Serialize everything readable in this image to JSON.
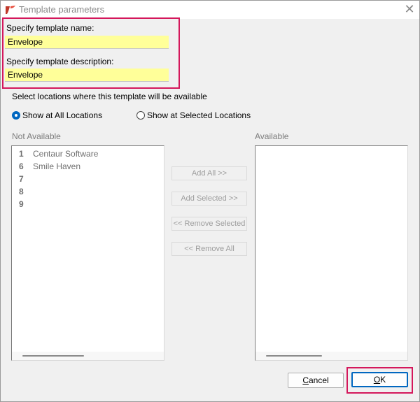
{
  "window": {
    "title": "Template parameters",
    "app_icon": "app-logo-icon",
    "close_icon": "close-icon",
    "close_glyph": "✕"
  },
  "fields": {
    "name_label": "Specify template name:",
    "name_value": "Envelope",
    "description_label": "Specify template description:",
    "description_value": "Envelope"
  },
  "locations": {
    "heading": "Select locations where this template will be available",
    "options": [
      {
        "label": "Show at All Locations",
        "selected": true
      },
      {
        "label": "Show at Selected Locations",
        "selected": false
      }
    ]
  },
  "not_available": {
    "header": "Not Available",
    "items": [
      {
        "num": "1",
        "name": "Centaur Software"
      },
      {
        "num": "6",
        "name": "Smile Haven"
      },
      {
        "num": "7",
        "name": ""
      },
      {
        "num": "8",
        "name": ""
      },
      {
        "num": "9",
        "name": ""
      }
    ]
  },
  "available": {
    "header": "Available",
    "items": []
  },
  "transfer_buttons": {
    "add_all": "Add All >>",
    "add_selected": "Add Selected >>",
    "remove_selected": "<< Remove Selected",
    "remove_all": "<< Remove All"
  },
  "footer": {
    "cancel_first": "C",
    "cancel_rest": "ancel",
    "ok_first": "O",
    "ok_rest": "K"
  },
  "colors": {
    "highlight": "#d4175b",
    "input_bg": "#ffff99",
    "accent": "#0067c0"
  }
}
